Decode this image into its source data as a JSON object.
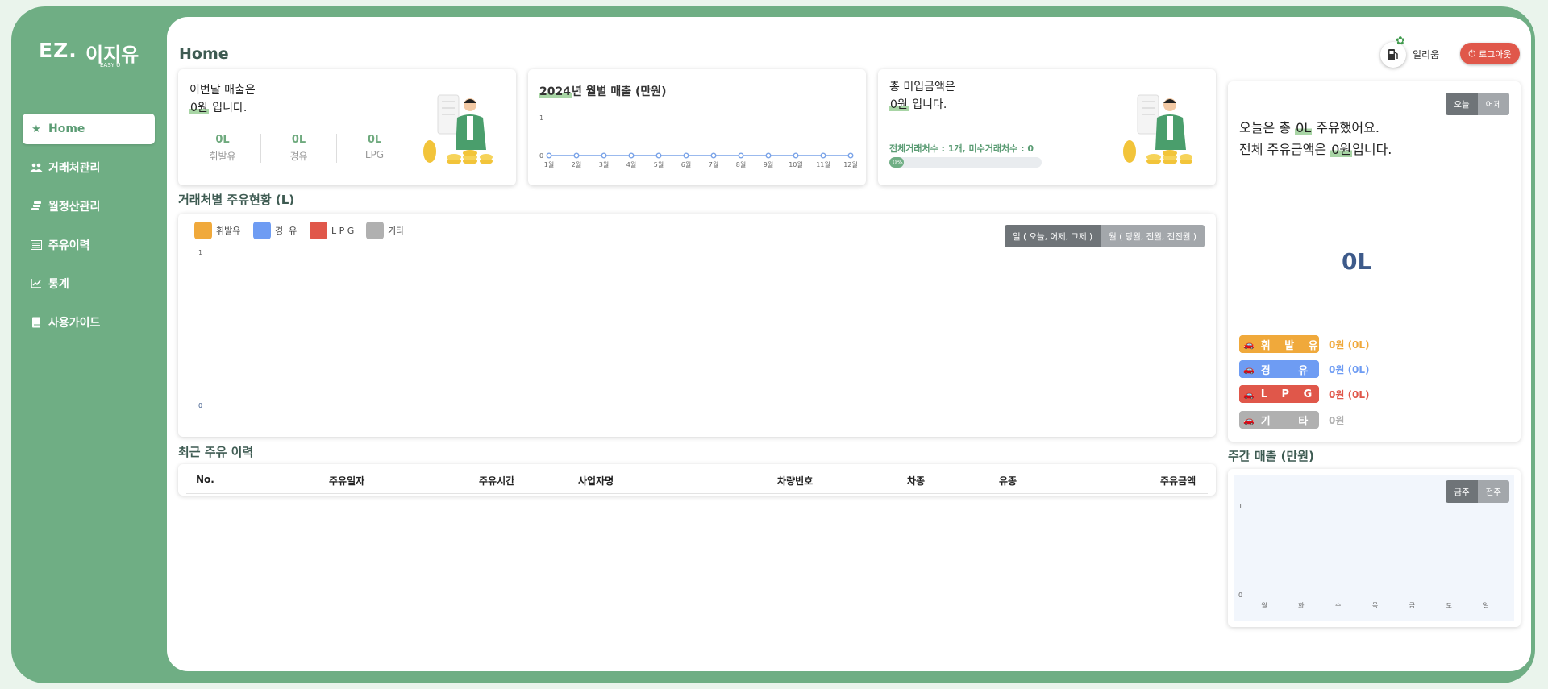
{
  "logo": {
    "ez": "EZ.",
    "name": "이지유",
    "sub": "EASY U"
  },
  "sidebar": {
    "items": [
      {
        "label": "Home",
        "icon": "star-icon"
      },
      {
        "label": "거래처관리",
        "icon": "users-icon"
      },
      {
        "label": "월정산관리",
        "icon": "coins-icon"
      },
      {
        "label": "주유이력",
        "icon": "list-icon"
      },
      {
        "label": "통계",
        "icon": "chart-line-icon"
      },
      {
        "label": "사용가이드",
        "icon": "book-icon"
      }
    ]
  },
  "header": {
    "title": "Home",
    "user_name": "일리움",
    "logout_label": "로그아웃"
  },
  "monthly_sales": {
    "line1": "이번달 매출은",
    "amount": "0원",
    "line2_suffix": " 입니다.",
    "stats": [
      {
        "value": "0L",
        "label": "휘발유"
      },
      {
        "value": "0L",
        "label": "경유"
      },
      {
        "value": "0L",
        "label": "LPG"
      }
    ]
  },
  "yearly_chart": {
    "title_year": "2024",
    "title_rest": "년 월별 매출 (만원)",
    "chart_data": {
      "type": "line",
      "title": "2024년 월별 매출 (만원)",
      "categories": [
        "1월",
        "2월",
        "3월",
        "4월",
        "5월",
        "6월",
        "7월",
        "8월",
        "9월",
        "10월",
        "11월",
        "12월"
      ],
      "values": [
        0,
        0,
        0,
        0,
        0,
        0,
        0,
        0,
        0,
        0,
        0,
        0
      ],
      "ylim": [
        0,
        1
      ],
      "y_ticks": [
        "0",
        "1"
      ],
      "color": "#7aa3e8"
    }
  },
  "unpaid": {
    "line1": "총 미입금액은",
    "amount": "0원",
    "line2_suffix": " 입니다.",
    "stats_text": "전체거래처수 : 1개,   미수거래처수 : 0",
    "progress": 0,
    "progress_label": "0%"
  },
  "client_fuel": {
    "title": "거래처별 주유현황 (L)",
    "legend": [
      {
        "label": "휘발유",
        "color": "#f0a93b"
      },
      {
        "label": "경  유",
        "color": "#6e9cf3"
      },
      {
        "label": "L P G",
        "color": "#e0574a"
      },
      {
        "label": "기타",
        "color": "#b0b0b0"
      }
    ],
    "buttons": [
      "일 ( 오늘, 어제, 그제 )",
      "월 ( 당월, 전월, 전전월 )"
    ],
    "chart_data": {
      "type": "bar",
      "categories": [],
      "series": [],
      "ylim": [
        0,
        1
      ],
      "y_ticks": [
        "0",
        "1"
      ]
    }
  },
  "recent": {
    "title": "최근 주유 이력",
    "columns": [
      "No.",
      "주유일자",
      "주유시간",
      "사업자명",
      "차량번호",
      "차종",
      "유종",
      "주유금액"
    ],
    "rows": []
  },
  "today": {
    "buttons": [
      "오늘",
      "어제"
    ],
    "line1_prefix": "오늘은 총 ",
    "line1_value": "0L",
    "line1_suffix": " 주유했어요.",
    "line2_prefix": "전체 주유금액은 ",
    "line2_value": "0원",
    "line2_suffix": "입니다.",
    "big_value": "0L",
    "fuels": [
      {
        "label": "휘 발 유",
        "amount": "0원 (0L)",
        "color": "#f0a93b"
      },
      {
        "label": "경 유",
        "amount": "0원 (0L)",
        "color": "#6e9cf3"
      },
      {
        "label": "L P G",
        "amount": "0원 (0L)",
        "color": "#e0574a"
      },
      {
        "label": "기 타",
        "amount": "0원",
        "color": "#b0b0b0"
      }
    ]
  },
  "weekly": {
    "title": "주간 매출 (만원)",
    "buttons": [
      "금주",
      "전주"
    ],
    "chart_data": {
      "type": "bar",
      "categories": [
        "월",
        "화",
        "수",
        "목",
        "금",
        "토",
        "일"
      ],
      "values": [
        0,
        0,
        0,
        0,
        0,
        0,
        0
      ],
      "ylim": [
        0,
        1
      ],
      "y_ticks": [
        "0",
        "1"
      ]
    }
  }
}
